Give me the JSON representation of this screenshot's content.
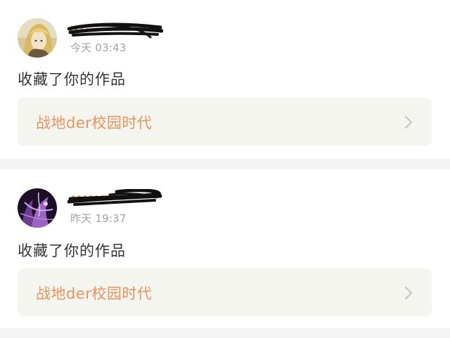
{
  "notifications": [
    {
      "username": "l••••••••••",
      "time": "今天 03:43",
      "action": "收藏了你的作品",
      "work_title": "战地der校园时代",
      "avatar_icon": "avatar-blonde-character",
      "username_redacted": true
    },
    {
      "username": "••••••••••",
      "time": "昨天 19:37",
      "action": "收藏了你的作品",
      "work_title": "战地der校园时代",
      "avatar_icon": "avatar-purple-character",
      "username_redacted": true
    }
  ],
  "colors": {
    "page_bg": "#f4f4f4",
    "card_bg": "#ffffff",
    "work_box_bg": "#f5f5f0",
    "accent_orange": "#e8935d",
    "text_primary": "#333333",
    "text_secondary": "#a3a3a3",
    "chevron": "#c4c4c4",
    "redaction": "#111111"
  }
}
